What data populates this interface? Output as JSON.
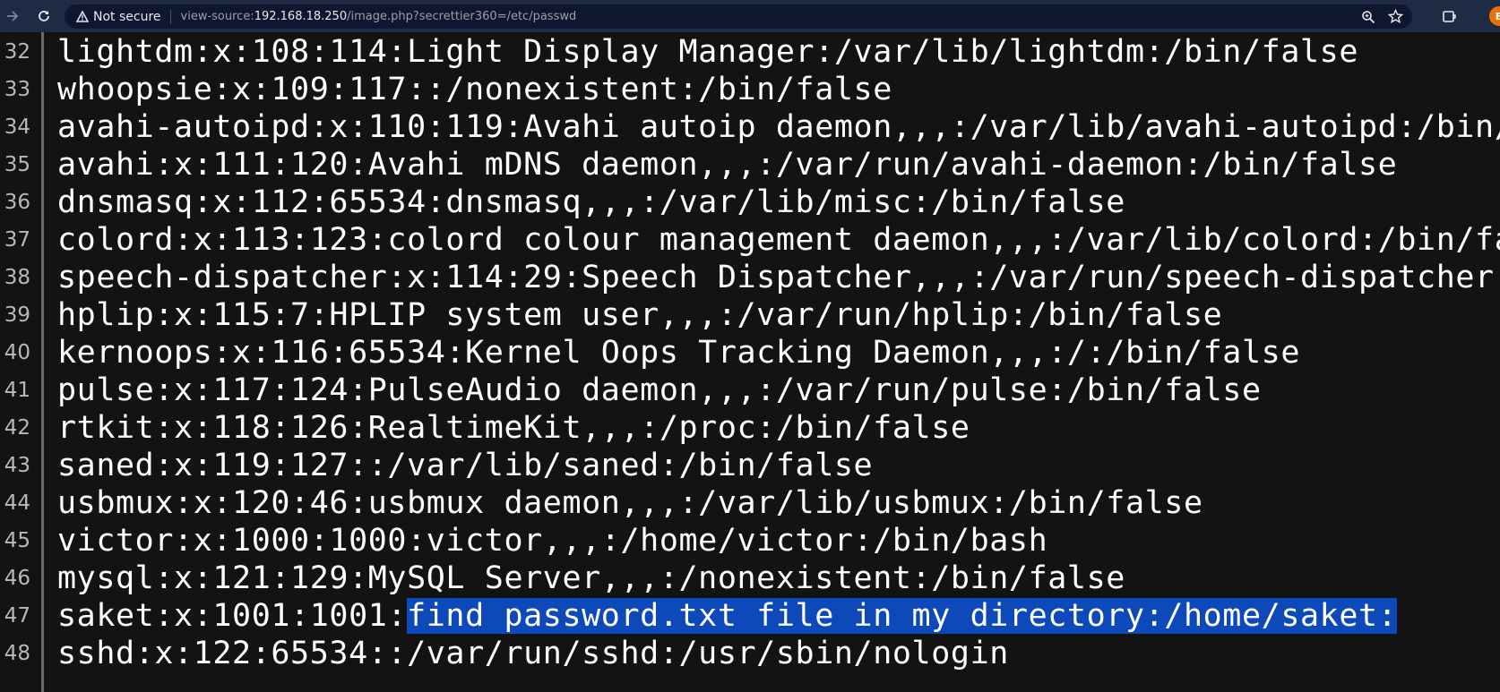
{
  "browser": {
    "security_label": "Not secure",
    "url_prefix": "view-source:",
    "url_host": "192.168.18.250",
    "url_path": "/image.php?secrettier360=/etc/passwd",
    "profile_initial": "B"
  },
  "source_lines": [
    {
      "num": "32",
      "text": "lightdm:x:108:114:Light Display Manager:/var/lib/lightdm:/bin/false",
      "selected": ""
    },
    {
      "num": "33",
      "text": "whoopsie:x:109:117::/nonexistent:/bin/false",
      "selected": ""
    },
    {
      "num": "34",
      "text": "avahi-autoipd:x:110:119:Avahi autoip daemon,,,:/var/lib/avahi-autoipd:/bin/false",
      "selected": ""
    },
    {
      "num": "35",
      "text": "avahi:x:111:120:Avahi mDNS daemon,,,:/var/run/avahi-daemon:/bin/false",
      "selected": ""
    },
    {
      "num": "36",
      "text": "dnsmasq:x:112:65534:dnsmasq,,,:/var/lib/misc:/bin/false",
      "selected": ""
    },
    {
      "num": "37",
      "text": "colord:x:113:123:colord colour management daemon,,,:/var/lib/colord:/bin/false",
      "selected": ""
    },
    {
      "num": "38",
      "text": "speech-dispatcher:x:114:29:Speech Dispatcher,,,:/var/run/speech-dispatcher:/bin/false",
      "selected": ""
    },
    {
      "num": "39",
      "text": "hplip:x:115:7:HPLIP system user,,,:/var/run/hplip:/bin/false",
      "selected": ""
    },
    {
      "num": "40",
      "text": "kernoops:x:116:65534:Kernel Oops Tracking Daemon,,,:/:/bin/false",
      "selected": ""
    },
    {
      "num": "41",
      "text": "pulse:x:117:124:PulseAudio daemon,,,:/var/run/pulse:/bin/false",
      "selected": ""
    },
    {
      "num": "42",
      "text": "rtkit:x:118:126:RealtimeKit,,,:/proc:/bin/false",
      "selected": ""
    },
    {
      "num": "43",
      "text": "saned:x:119:127::/var/lib/saned:/bin/false",
      "selected": ""
    },
    {
      "num": "44",
      "text": "usbmux:x:120:46:usbmux daemon,,,:/var/lib/usbmux:/bin/false",
      "selected": ""
    },
    {
      "num": "45",
      "text": "victor:x:1000:1000:victor,,,:/home/victor:/bin/bash",
      "selected": ""
    },
    {
      "num": "46",
      "text": "mysql:x:121:129:MySQL Server,,,:/nonexistent:/bin/false",
      "selected": ""
    },
    {
      "num": "47",
      "text": "saket:x:1001:1001:",
      "selected": "find password.txt file in my directory:/home/saket:"
    },
    {
      "num": "48",
      "text": "sshd:x:122:65534::/var/run/sshd:/usr/sbin/nologin",
      "selected": ""
    }
  ],
  "colors": {
    "toolbar_bg": "#1f2a44",
    "page_bg": "#131313",
    "selection": "#0d49b8"
  }
}
